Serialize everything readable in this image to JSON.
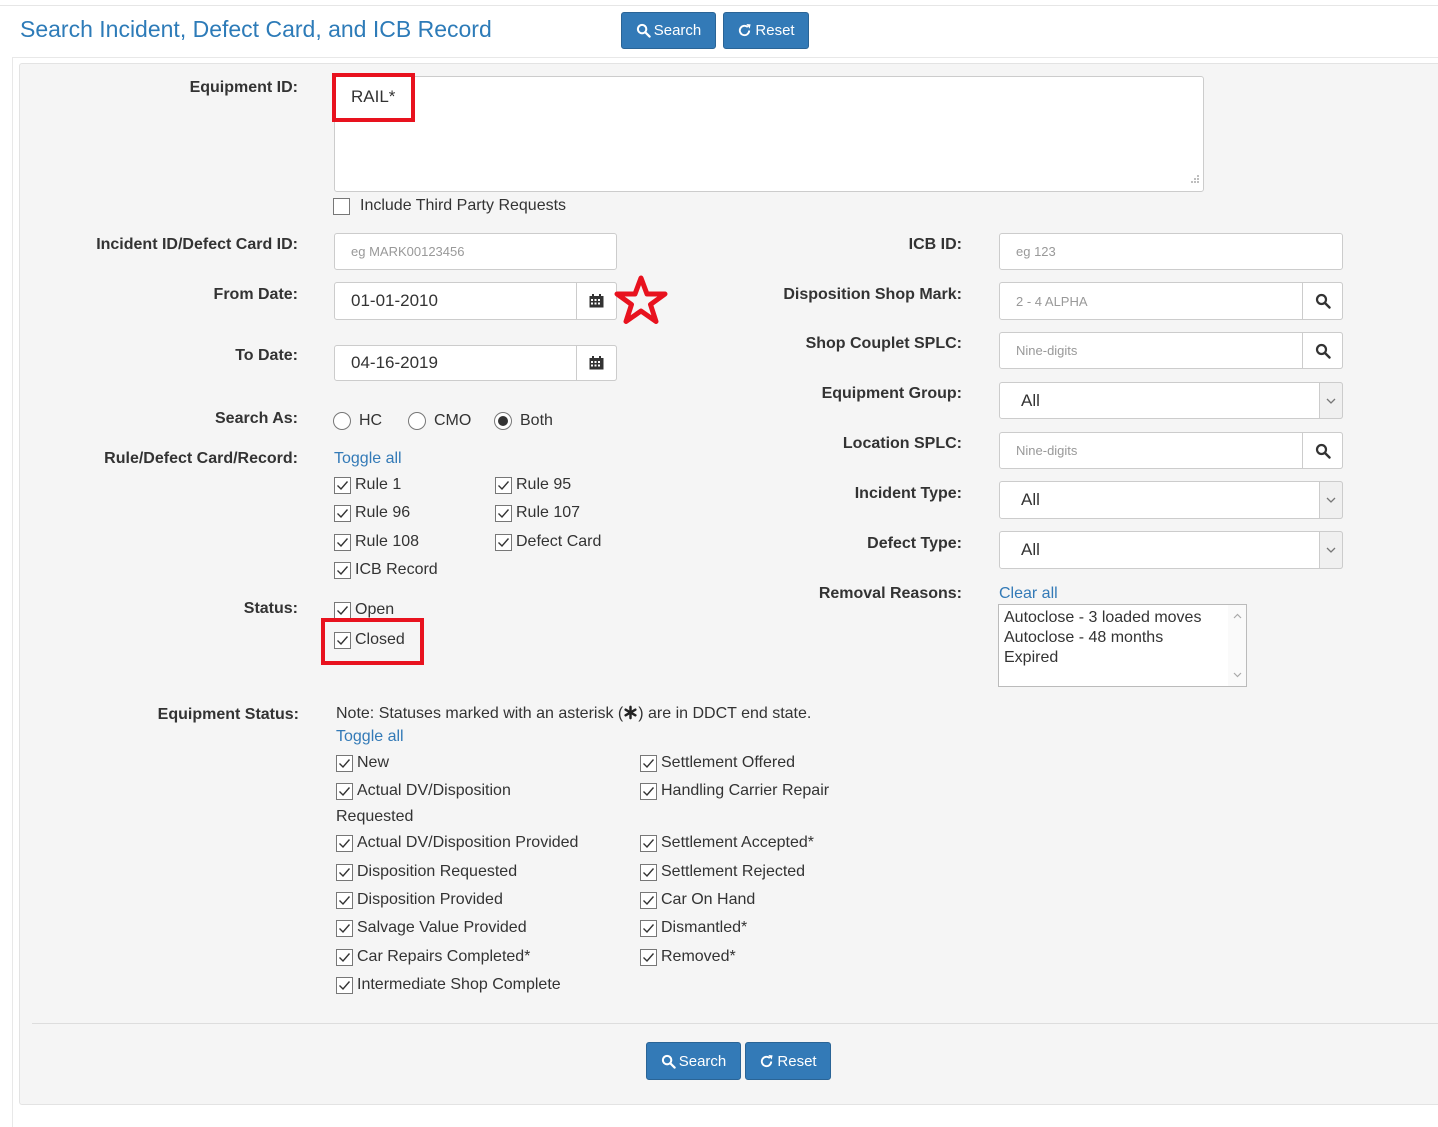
{
  "header": {
    "title": "Search Incident, Defect Card, and ICB Record",
    "search_label": "Search",
    "reset_label": "Reset"
  },
  "equipment_id": {
    "label": "Equipment ID:",
    "value": "RAIL*"
  },
  "third_party": {
    "label": "Include Third Party Requests",
    "checked": false
  },
  "incident_id": {
    "label": "Incident ID/Defect Card ID:",
    "placeholder": "eg MARK00123456"
  },
  "from_date": {
    "label": "From Date:",
    "value": "01-01-2010"
  },
  "to_date": {
    "label": "To Date:",
    "value": "04-16-2019"
  },
  "search_as": {
    "label": "Search As:",
    "options": [
      "HC",
      "CMO",
      "Both"
    ],
    "selected": "Both"
  },
  "rule_defect": {
    "label": "Rule/Defect Card/Record:",
    "toggle_label": "Toggle all",
    "items": [
      "Rule 1",
      "Rule 95",
      "Rule 96",
      "Rule 107",
      "Rule 108",
      "Defect Card",
      "ICB Record"
    ]
  },
  "status": {
    "label": "Status:",
    "items": [
      "Open",
      "Closed"
    ]
  },
  "icb_id": {
    "label": "ICB ID:",
    "placeholder": "eg 123"
  },
  "disposition_shop_mark": {
    "label": "Disposition Shop Mark:",
    "placeholder": "2 - 4 ALPHA"
  },
  "shop_couplet_splc": {
    "label": "Shop Couplet SPLC:",
    "placeholder": "Nine-digits"
  },
  "equipment_group": {
    "label": "Equipment Group:",
    "value": "All"
  },
  "location_splc": {
    "label": "Location SPLC:",
    "placeholder": "Nine-digits"
  },
  "incident_type": {
    "label": "Incident Type:",
    "value": "All"
  },
  "defect_type": {
    "label": "Defect Type:",
    "value": "All"
  },
  "removal_reasons": {
    "label": "Removal Reasons:",
    "clear_label": "Clear all",
    "options": [
      "Autoclose - 3 loaded moves",
      "Autoclose - 48 months",
      "Expired"
    ]
  },
  "equipment_status": {
    "label": "Equipment Status:",
    "note_before": "Note: Statuses marked with an asterisk (",
    "note_after": ") are in DDCT end state.",
    "toggle_label": "Toggle all",
    "left": [
      "New",
      "Actual DV/Disposition",
      "Requested",
      "Actual DV/Disposition Provided",
      "Disposition Requested",
      "Disposition Provided",
      "Salvage Value Provided",
      "Car Repairs Completed*",
      "Intermediate Shop Complete"
    ],
    "right": [
      "Settlement Offered",
      "Handling Carrier Repair",
      "Settlement Accepted*",
      "Settlement Rejected",
      "Car On Hand",
      "Dismantled*",
      "Removed*"
    ]
  },
  "footer": {
    "search_label": "Search",
    "reset_label": "Reset"
  },
  "colors": {
    "primary": "#337ab7",
    "title": "#2d7bb8",
    "highlight": "#e8121e",
    "panel": "#f5f5f5"
  }
}
